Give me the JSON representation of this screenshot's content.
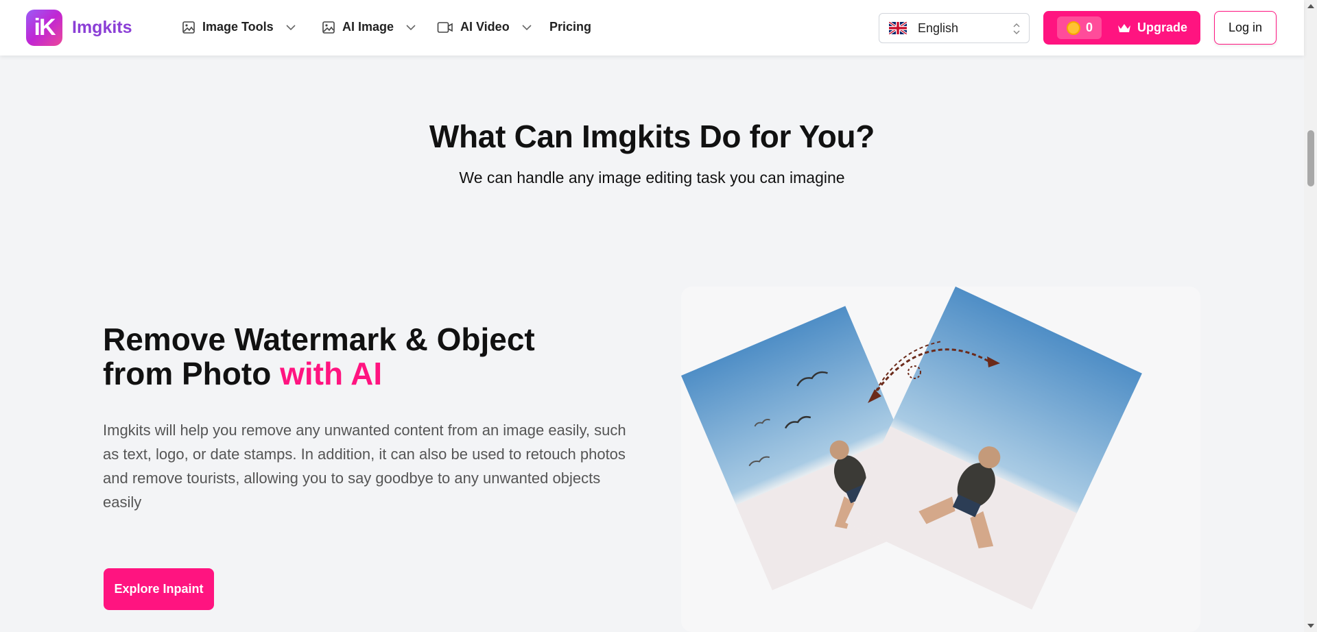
{
  "header": {
    "logo_text": "iK",
    "brand": "Imgkits",
    "nav": [
      {
        "label": "Image Tools",
        "icon": "image-icon"
      },
      {
        "label": "AI Image",
        "icon": "image-icon"
      },
      {
        "label": "AI Video",
        "icon": "video-icon"
      },
      {
        "label": "Pricing"
      }
    ],
    "language": {
      "selected": "English",
      "flag": "uk-flag-icon"
    },
    "credits": "0",
    "upgrade_label": "Upgrade",
    "login_label": "Log in"
  },
  "section": {
    "title": "What Can Imgkits Do for You?",
    "subtitle": "We can handle any image editing task you can imagine"
  },
  "feature": {
    "title_main": "Remove Watermark & Object from Photo ",
    "title_accent": "with AI",
    "description": "Imgkits will help you remove any unwanted content from an image easily, such as text, logo, or date stamps. In addition, it can also be used to retouch photos and remove tourists, allowing you to say goodbye to any unwanted objects easily",
    "cta_label": "Explore Inpaint"
  },
  "colors": {
    "brand_pink": "#ff1480",
    "brand_purple": "#8b3fd6",
    "page_bg": "#f3f4f6"
  }
}
